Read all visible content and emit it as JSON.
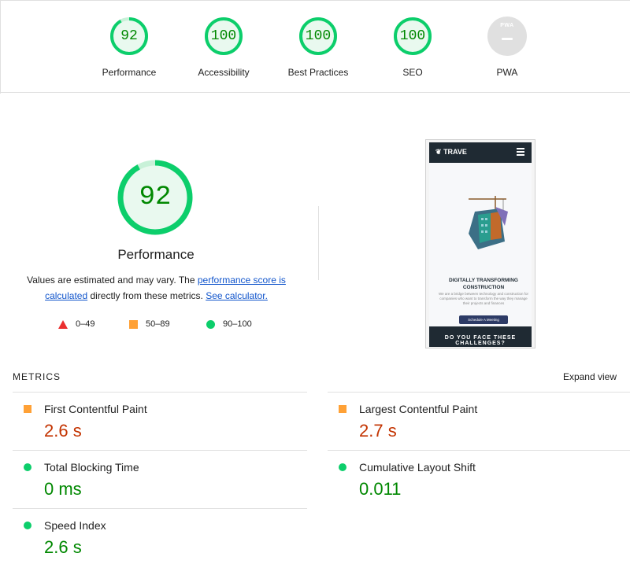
{
  "summary": {
    "categories": [
      {
        "label": "Performance",
        "score": "92",
        "fraction": 0.92
      },
      {
        "label": "Accessibility",
        "score": "100",
        "fraction": 1.0
      },
      {
        "label": "Best Practices",
        "score": "100",
        "fraction": 1.0
      },
      {
        "label": "SEO",
        "score": "100",
        "fraction": 1.0
      },
      {
        "label": "PWA",
        "badge": "PWA",
        "score": "—"
      }
    ]
  },
  "performance": {
    "score": "92",
    "fraction": 0.92,
    "title": "Performance",
    "desc_before": "Values are estimated and may vary. The ",
    "desc_link": "performance score is calculated",
    "desc_middle": " directly from these metrics. ",
    "calc_link": "See calculator."
  },
  "legend": [
    {
      "shape": "triangle",
      "range": "0–49",
      "color": "#eb2f2f"
    },
    {
      "shape": "square",
      "range": "50–89",
      "color": "#ffa136"
    },
    {
      "shape": "circle",
      "range": "90–100",
      "color": "#0cce6b"
    }
  ],
  "screenshot": {
    "brand": "TRAVE",
    "headline": "DIGITALLY TRANSFORMING CONSTRUCTION",
    "subtext": "We are a bridge between technology and construction for companies who want to transform the way they manage their projects and finances",
    "cta": "Schedule A Meeting",
    "footer": "DO YOU FACE THESE CHALLENGES?"
  },
  "metrics": {
    "header": "METRICS",
    "expand_label": "Expand view",
    "items": [
      {
        "title": "First Contentful Paint",
        "value": "2.6 s",
        "status": "average"
      },
      {
        "title": "Largest Contentful Paint",
        "value": "2.7 s",
        "status": "average"
      },
      {
        "title": "Total Blocking Time",
        "value": "0 ms",
        "status": "pass"
      },
      {
        "title": "Cumulative Layout Shift",
        "value": "0.011",
        "status": "pass"
      },
      {
        "title": "Speed Index",
        "value": "2.6 s",
        "status": "pass"
      }
    ]
  },
  "colors": {
    "pass": "#0cce6b",
    "pass_text": "#008800",
    "average": "#ffa136",
    "average_text": "#c33300",
    "fail": "#eb2f2f",
    "link": "#1155cc"
  }
}
